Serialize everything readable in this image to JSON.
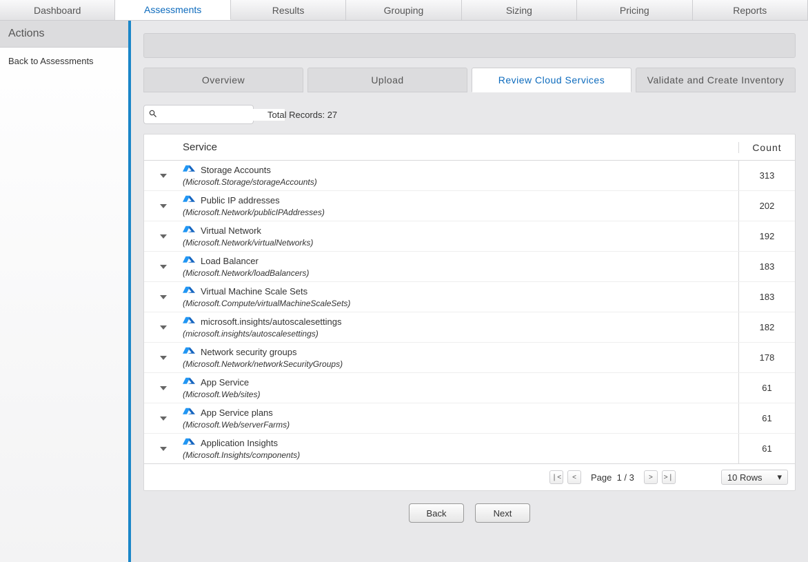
{
  "topnav": {
    "tabs": [
      "Dashboard",
      "Assessments",
      "Results",
      "Grouping",
      "Sizing",
      "Pricing",
      "Reports"
    ],
    "active_index": 1
  },
  "sidebar": {
    "title": "Actions",
    "back_link": "Back to Assessments"
  },
  "subtabs": {
    "tabs": [
      "Overview",
      "Upload",
      "Review Cloud Services",
      "Validate and Create Inventory"
    ],
    "active_index": 2
  },
  "search": {
    "placeholder": ""
  },
  "total_records_label": "Total Records: 27",
  "table": {
    "headers": {
      "service": "Service",
      "count": "Count"
    },
    "rows": [
      {
        "name": "Storage Accounts",
        "sub": "(Microsoft.Storage/storageAccounts)",
        "count": 313
      },
      {
        "name": "Public IP addresses",
        "sub": "(Microsoft.Network/publicIPAddresses)",
        "count": 202
      },
      {
        "name": "Virtual Network",
        "sub": "(Microsoft.Network/virtualNetworks)",
        "count": 192
      },
      {
        "name": "Load Balancer",
        "sub": "(Microsoft.Network/loadBalancers)",
        "count": 183
      },
      {
        "name": "Virtual Machine Scale Sets",
        "sub": "(Microsoft.Compute/virtualMachineScaleSets)",
        "count": 183
      },
      {
        "name": "microsoft.insights/autoscalesettings",
        "sub": "(microsoft.insights/autoscalesettings)",
        "count": 182
      },
      {
        "name": "Network security groups",
        "sub": "(Microsoft.Network/networkSecurityGroups)",
        "count": 178
      },
      {
        "name": "App Service",
        "sub": "(Microsoft.Web/sites)",
        "count": 61
      },
      {
        "name": "App Service plans",
        "sub": "(Microsoft.Web/serverFarms)",
        "count": 61
      },
      {
        "name": "Application Insights",
        "sub": "(Microsoft.Insights/components)",
        "count": 61
      }
    ]
  },
  "pager": {
    "label": "Page",
    "current": "1 / 3",
    "rows_select": "10 Rows"
  },
  "buttons": {
    "back": "Back",
    "next": "Next"
  }
}
